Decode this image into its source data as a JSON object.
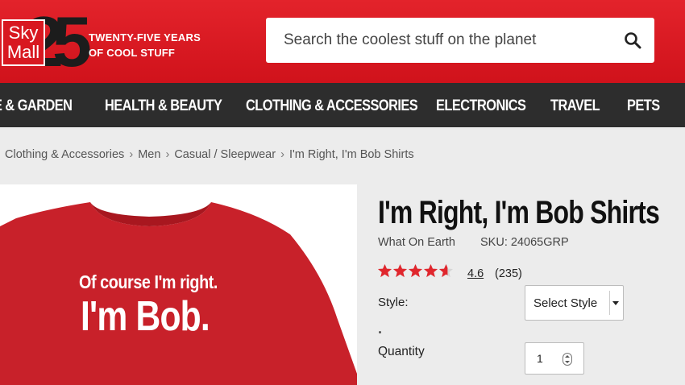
{
  "header": {
    "logo": {
      "line1": "Sky",
      "line2": "Mall",
      "number": "25"
    },
    "tagline": {
      "line1": "TWENTY-FIVE YEARS",
      "line2": "OF COOL STUFF"
    },
    "search": {
      "placeholder": "Search the coolest stuff on the planet",
      "icon": "search-icon"
    },
    "colors": {
      "brand_red": "#d81820",
      "nav_bg": "#2d2d2d"
    }
  },
  "nav": {
    "items": [
      {
        "label": "E & GARDEN"
      },
      {
        "label": "HEALTH & BEAUTY"
      },
      {
        "label": "CLOTHING & ACCESSORIES"
      },
      {
        "label": "ELECTRONICS"
      },
      {
        "label": "TRAVEL"
      },
      {
        "label": "PETS"
      }
    ]
  },
  "breadcrumb": {
    "items": [
      "Clothing & Accessories",
      "Men",
      "Casual / Sleepwear",
      "I'm Right, I'm Bob Shirts"
    ],
    "separator": "›"
  },
  "product": {
    "image_text_line1": "Of course I'm right.",
    "image_text_line2": "I'm Bob.",
    "shirt_color": "#c8212a",
    "title": "I'm Right, I'm Bob Shirts",
    "brand": "What On Earth",
    "sku": "SKU: 24065GRP",
    "rating_value": "4.6",
    "rating_stars": 4.6,
    "rating_count": "(235)",
    "star_color": "#e0262d",
    "style_label": "Style:",
    "style_select": "Select Style",
    "quantity_label": "Quantity",
    "quantity_value": "1"
  }
}
